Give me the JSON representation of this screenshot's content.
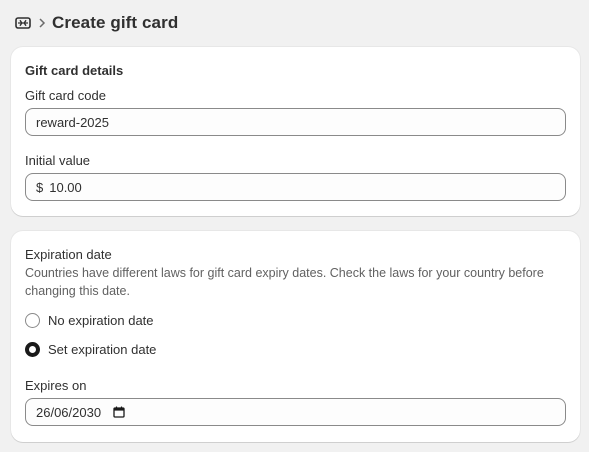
{
  "header": {
    "title": "Create gift card"
  },
  "details": {
    "title": "Gift card details",
    "code_label": "Gift card code",
    "code_value": "reward-2025",
    "value_label": "Initial value",
    "currency": "$",
    "value": "10.00"
  },
  "expiration": {
    "title": "Expiration date",
    "description": "Countries have different laws for gift card expiry dates. Check the laws for your country before changing this date.",
    "options": [
      {
        "label": "No expiration date",
        "selected": false
      },
      {
        "label": "Set expiration date",
        "selected": true
      }
    ],
    "expires_label": "Expires on",
    "expires_value": "26/06/2030"
  },
  "icons": {
    "header": "gift-card-icon",
    "breadcrumb": "chevron-right-icon",
    "date": "calendar-icon"
  }
}
